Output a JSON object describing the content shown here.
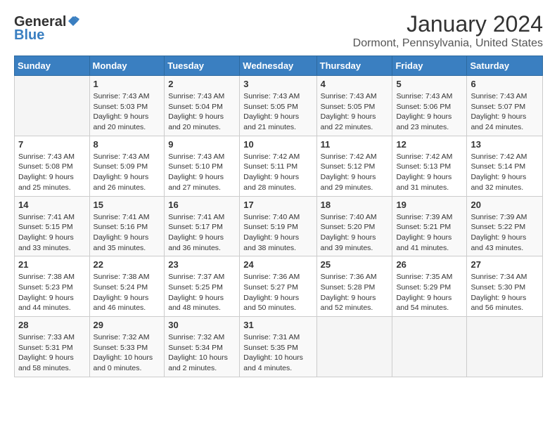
{
  "header": {
    "logo_general": "General",
    "logo_blue": "Blue",
    "month_year": "January 2024",
    "location": "Dormont, Pennsylvania, United States"
  },
  "weekdays": [
    "Sunday",
    "Monday",
    "Tuesday",
    "Wednesday",
    "Thursday",
    "Friday",
    "Saturday"
  ],
  "weeks": [
    [
      {
        "day": "",
        "info": ""
      },
      {
        "day": "1",
        "info": "Sunrise: 7:43 AM\nSunset: 5:03 PM\nDaylight: 9 hours\nand 20 minutes."
      },
      {
        "day": "2",
        "info": "Sunrise: 7:43 AM\nSunset: 5:04 PM\nDaylight: 9 hours\nand 20 minutes."
      },
      {
        "day": "3",
        "info": "Sunrise: 7:43 AM\nSunset: 5:05 PM\nDaylight: 9 hours\nand 21 minutes."
      },
      {
        "day": "4",
        "info": "Sunrise: 7:43 AM\nSunset: 5:05 PM\nDaylight: 9 hours\nand 22 minutes."
      },
      {
        "day": "5",
        "info": "Sunrise: 7:43 AM\nSunset: 5:06 PM\nDaylight: 9 hours\nand 23 minutes."
      },
      {
        "day": "6",
        "info": "Sunrise: 7:43 AM\nSunset: 5:07 PM\nDaylight: 9 hours\nand 24 minutes."
      }
    ],
    [
      {
        "day": "7",
        "info": "Sunrise: 7:43 AM\nSunset: 5:08 PM\nDaylight: 9 hours\nand 25 minutes."
      },
      {
        "day": "8",
        "info": "Sunrise: 7:43 AM\nSunset: 5:09 PM\nDaylight: 9 hours\nand 26 minutes."
      },
      {
        "day": "9",
        "info": "Sunrise: 7:43 AM\nSunset: 5:10 PM\nDaylight: 9 hours\nand 27 minutes."
      },
      {
        "day": "10",
        "info": "Sunrise: 7:42 AM\nSunset: 5:11 PM\nDaylight: 9 hours\nand 28 minutes."
      },
      {
        "day": "11",
        "info": "Sunrise: 7:42 AM\nSunset: 5:12 PM\nDaylight: 9 hours\nand 29 minutes."
      },
      {
        "day": "12",
        "info": "Sunrise: 7:42 AM\nSunset: 5:13 PM\nDaylight: 9 hours\nand 31 minutes."
      },
      {
        "day": "13",
        "info": "Sunrise: 7:42 AM\nSunset: 5:14 PM\nDaylight: 9 hours\nand 32 minutes."
      }
    ],
    [
      {
        "day": "14",
        "info": "Sunrise: 7:41 AM\nSunset: 5:15 PM\nDaylight: 9 hours\nand 33 minutes."
      },
      {
        "day": "15",
        "info": "Sunrise: 7:41 AM\nSunset: 5:16 PM\nDaylight: 9 hours\nand 35 minutes."
      },
      {
        "day": "16",
        "info": "Sunrise: 7:41 AM\nSunset: 5:17 PM\nDaylight: 9 hours\nand 36 minutes."
      },
      {
        "day": "17",
        "info": "Sunrise: 7:40 AM\nSunset: 5:19 PM\nDaylight: 9 hours\nand 38 minutes."
      },
      {
        "day": "18",
        "info": "Sunrise: 7:40 AM\nSunset: 5:20 PM\nDaylight: 9 hours\nand 39 minutes."
      },
      {
        "day": "19",
        "info": "Sunrise: 7:39 AM\nSunset: 5:21 PM\nDaylight: 9 hours\nand 41 minutes."
      },
      {
        "day": "20",
        "info": "Sunrise: 7:39 AM\nSunset: 5:22 PM\nDaylight: 9 hours\nand 43 minutes."
      }
    ],
    [
      {
        "day": "21",
        "info": "Sunrise: 7:38 AM\nSunset: 5:23 PM\nDaylight: 9 hours\nand 44 minutes."
      },
      {
        "day": "22",
        "info": "Sunrise: 7:38 AM\nSunset: 5:24 PM\nDaylight: 9 hours\nand 46 minutes."
      },
      {
        "day": "23",
        "info": "Sunrise: 7:37 AM\nSunset: 5:25 PM\nDaylight: 9 hours\nand 48 minutes."
      },
      {
        "day": "24",
        "info": "Sunrise: 7:36 AM\nSunset: 5:27 PM\nDaylight: 9 hours\nand 50 minutes."
      },
      {
        "day": "25",
        "info": "Sunrise: 7:36 AM\nSunset: 5:28 PM\nDaylight: 9 hours\nand 52 minutes."
      },
      {
        "day": "26",
        "info": "Sunrise: 7:35 AM\nSunset: 5:29 PM\nDaylight: 9 hours\nand 54 minutes."
      },
      {
        "day": "27",
        "info": "Sunrise: 7:34 AM\nSunset: 5:30 PM\nDaylight: 9 hours\nand 56 minutes."
      }
    ],
    [
      {
        "day": "28",
        "info": "Sunrise: 7:33 AM\nSunset: 5:31 PM\nDaylight: 9 hours\nand 58 minutes."
      },
      {
        "day": "29",
        "info": "Sunrise: 7:32 AM\nSunset: 5:33 PM\nDaylight: 10 hours\nand 0 minutes."
      },
      {
        "day": "30",
        "info": "Sunrise: 7:32 AM\nSunset: 5:34 PM\nDaylight: 10 hours\nand 2 minutes."
      },
      {
        "day": "31",
        "info": "Sunrise: 7:31 AM\nSunset: 5:35 PM\nDaylight: 10 hours\nand 4 minutes."
      },
      {
        "day": "",
        "info": ""
      },
      {
        "day": "",
        "info": ""
      },
      {
        "day": "",
        "info": ""
      }
    ]
  ]
}
